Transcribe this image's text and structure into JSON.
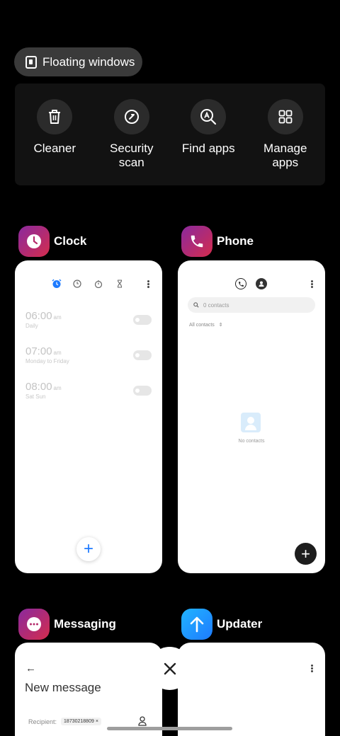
{
  "floating": {
    "label": "Floating windows"
  },
  "tools": [
    {
      "label": "Cleaner",
      "icon": "trash-icon"
    },
    {
      "label": "Security scan",
      "icon": "security-scan-icon"
    },
    {
      "label": "Find apps",
      "icon": "find-apps-icon"
    },
    {
      "label": "Manage apps",
      "icon": "grid-icon"
    }
  ],
  "apps": {
    "clock": {
      "name": "Clock",
      "alarms": [
        {
          "time": "06:00",
          "ampm": "am",
          "repeat": "Daily"
        },
        {
          "time": "07:00",
          "ampm": "am",
          "repeat": "Monday to Friday"
        },
        {
          "time": "08:00",
          "ampm": "am",
          "repeat": "Sat Sun"
        }
      ],
      "fab": "+"
    },
    "phone": {
      "name": "Phone",
      "search_placeholder": "0 contacts",
      "filter": "All contacts",
      "empty": "No contacts",
      "fab": "+"
    },
    "messaging": {
      "name": "Messaging",
      "back": "←",
      "title": "New message",
      "recipient_label": "Recipient:",
      "recipient_value": "18730218809",
      "recipient_remove": "×"
    },
    "updater": {
      "name": "Updater"
    }
  },
  "colors": {
    "accent": "#1e7bff",
    "icon_gradient_red": [
      "#8a2a9e",
      "#d42c4d"
    ],
    "icon_gradient_blue": [
      "#21b4ff",
      "#1e7bff"
    ]
  },
  "close": {
    "icon": "close-icon"
  }
}
